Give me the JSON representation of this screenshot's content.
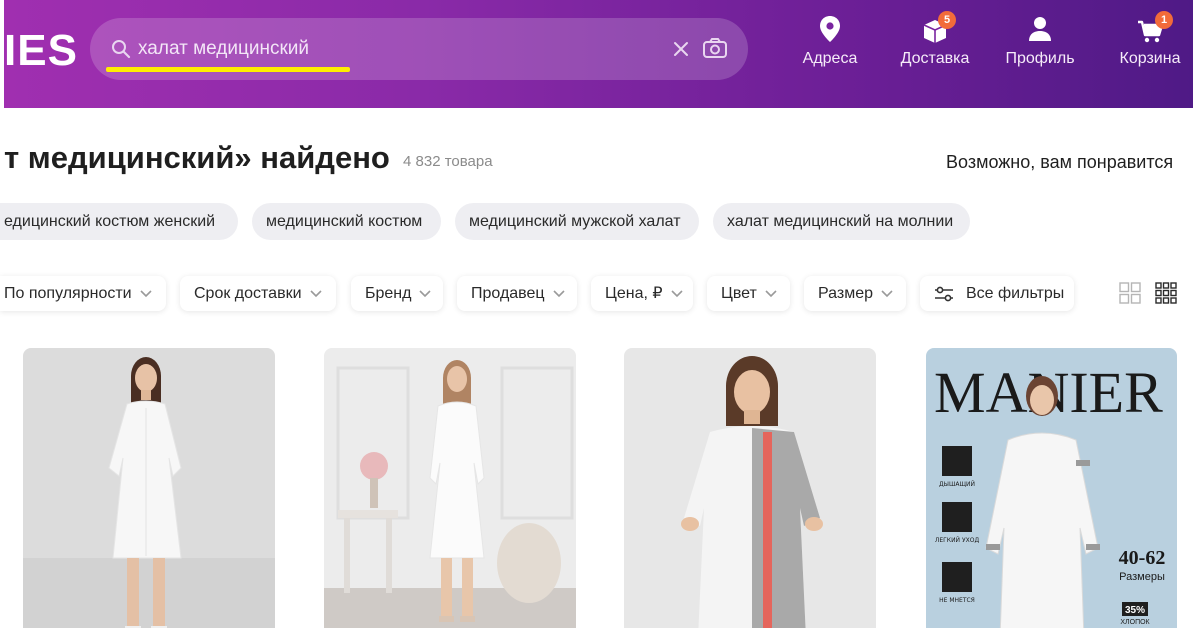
{
  "header": {
    "logo_text": "IES",
    "search": {
      "value": "халат медицинский"
    },
    "nav": [
      {
        "label": "Адреса",
        "icon": "location-pin-icon"
      },
      {
        "label": "Доставка",
        "icon": "box-icon",
        "badge": "5"
      },
      {
        "label": "Профиль",
        "icon": "user-icon"
      },
      {
        "label": "Корзина",
        "icon": "cart-icon",
        "badge": "1"
      }
    ],
    "colors": {
      "gradient_start": "#a02fb0",
      "gradient_end": "#4f1a86",
      "badge": "#f26b3a",
      "highlight": "#ffee00"
    }
  },
  "results": {
    "title": "т медицинский» найдено",
    "count": "4 832 товара",
    "maybe_like": "Возможно, вам понравится"
  },
  "suggestions": [
    "едицинский костюм женский",
    "медицинский костюм",
    "медицинский мужской халат",
    "халат медицинский на молнии"
  ],
  "filters": [
    "По популярности",
    "Срок доставки",
    "Бренд",
    "Продавец",
    "Цена, ₽",
    "Цвет",
    "Размер"
  ],
  "all_filters_label": "Все фильтры",
  "products": [
    {
      "image": "white-medical-gown-model-1"
    },
    {
      "image": "white-medical-gown-model-2"
    },
    {
      "image": "white-gray-red-medical-gown"
    },
    {
      "image": "manier-promo-gown",
      "brand_text": "MANIER",
      "features": [
        "ДЫШАЩИЙ",
        "ЛЕГКИЙ УХОД",
        "НЕ МНЕТСЯ"
      ],
      "sizes": "40-62",
      "sizes_label": "Размеры",
      "cotton_pct": "35%",
      "cotton_label": "ХЛОПОК"
    }
  ]
}
